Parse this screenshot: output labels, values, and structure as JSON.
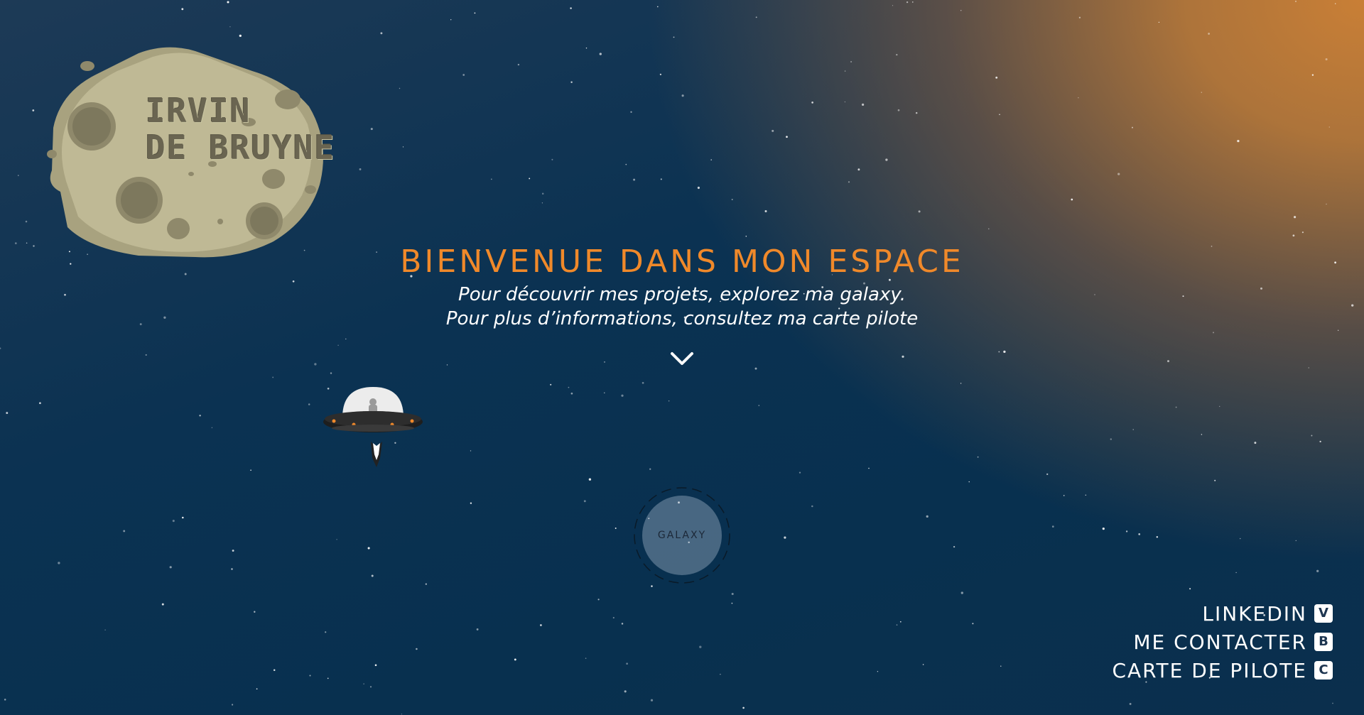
{
  "asteroid": {
    "line1": "IRVIN",
    "line2": "DE BRUYNE"
  },
  "hero": {
    "title": "BIENVENUE DANS MON ESPACE",
    "subtitle_line1": "Pour découvrir mes projets, explorez ma galaxy.",
    "subtitle_line2": "Pour plus d’informations, consultez ma carte pilote"
  },
  "galaxy": {
    "label": "GALAXY"
  },
  "links": [
    {
      "label": "LINKEDIN",
      "key": "V"
    },
    {
      "label": "ME CONTACTER",
      "key": "B"
    },
    {
      "label": "CARTE DE PILOTE",
      "key": "C"
    }
  ],
  "colors": {
    "accent": "#f0892a",
    "asteroid": "#b6b08c",
    "text": "#ffffff"
  }
}
